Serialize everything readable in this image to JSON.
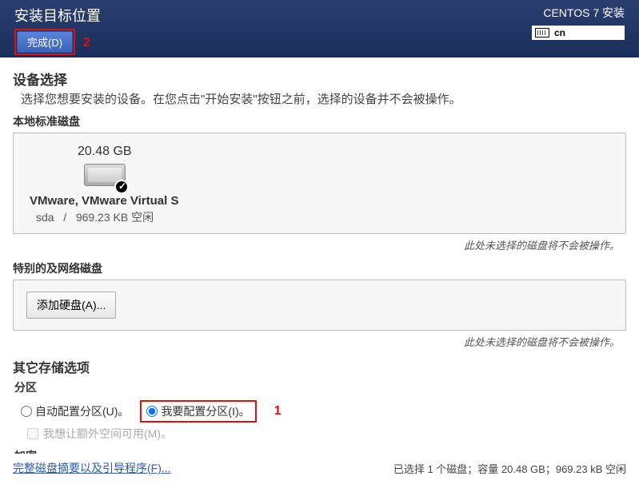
{
  "header": {
    "page_title": "安装目标位置",
    "done_button": "完成(D)",
    "annotation_2": "2",
    "installer_title": "CENTOS 7 安装",
    "lang_code": "cn"
  },
  "device_selection": {
    "title": "设备选择",
    "help": "选择您想要安装的设备。在您点击\"开始安装\"按钮之前，选择的设备并不会被操作。",
    "local_disks_title": "本地标准磁盘",
    "disk": {
      "size": "20.48 GB",
      "name": "VMware, VMware Virtual S",
      "dev": "sda",
      "sep": "/",
      "free": "969.23 KB 空闲"
    },
    "note1": "此处未选择的磁盘将不会被操作。",
    "special_disks_title": "特别的及网络磁盘",
    "add_disk_button": "添加硬盘(A)...",
    "note2": "此处未选择的磁盘将不会被操作。"
  },
  "other_options": {
    "title": "其它存储选项",
    "partition_title": "分区",
    "auto_partition": "自动配置分区(U)。",
    "manual_partition": "我要配置分区(I)。",
    "annotation_1": "1",
    "extra_space": "我想让额外空间可用(M)。",
    "encryption_title": "加密"
  },
  "footer": {
    "link": "完整磁盘摘要以及引导程序(F)...",
    "status": "已选择 1 个磁盘；容量 20.48 GB；969.23 kB 空闲"
  }
}
